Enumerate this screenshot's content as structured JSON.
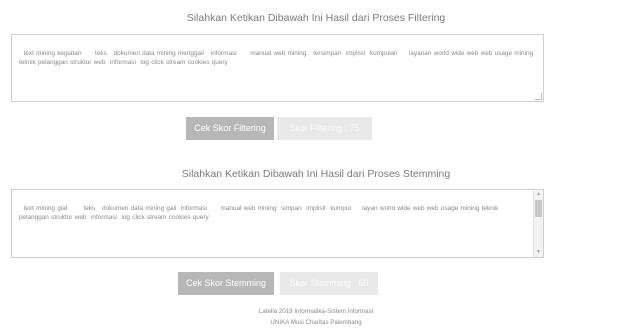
{
  "filtering": {
    "title": "Silahkan Ketikan Dibawah Ini Hasil dari Proses Filtering",
    "text": "text mining kegiatan      teks   dokumen data mining menggali   informasi      manual web mining   tersimpan  implisit  kumpulan     layanan world wide web web usage mining teknik pelanggan struktur web  informasi  log click stream cookies query",
    "button_label": "Cek Skor Filtering",
    "score_label": "Skor Filtering : 75"
  },
  "stemming": {
    "title": "Silahkan Ketikan Dibawah Ini Hasil dari Proses Stemming",
    "text": "text mining giat       teks   dokumen data mining gali  informasi      manual web mining  simpan  implisit  kumpul     layan world wide web web usage mining teknik pelanggan struktur web  informasi  log click stream cookies query",
    "button_label": "Cek Skor Stemming",
    "score_label": "Skor Stemming : 60"
  },
  "footer": {
    "line1": "Latella 2019 Informatika-Sistem Informasi",
    "line2": "UNIKA Musi Charitas Palembang"
  }
}
